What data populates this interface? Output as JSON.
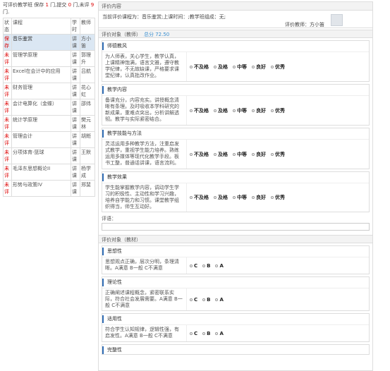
{
  "summary": {
    "prefix": "可评价教学班 ",
    "saved_label": "保存",
    "saved_count": "1",
    "mid": " 门,提交 ",
    "submitted_count": "0",
    "mid2": " 门,未评 ",
    "pending_count": "9",
    "suffix": " 门."
  },
  "course_table": {
    "headers": [
      "状态",
      "课程",
      "学时",
      "教师"
    ],
    "rows": [
      {
        "status": "保存",
        "course": "音乐鉴赏",
        "hours": "讲课",
        "teacher": "方小笛",
        "selected": true
      },
      {
        "status": "未评",
        "course": "管理学原理",
        "hours": "讲课",
        "teacher": "郭理升"
      },
      {
        "status": "未评",
        "course": "Excel在会计中的应用",
        "hours": "讲课",
        "teacher": "吕航"
      },
      {
        "status": "未评",
        "course": "财务管理",
        "hours": "讲课",
        "teacher": "花心虹"
      },
      {
        "status": "未评",
        "course": "会计电算化（金蝶）",
        "hours": "讲课",
        "teacher": "邵纬"
      },
      {
        "status": "未评",
        "course": "统计学原理",
        "hours": "讲课",
        "teacher": "樊元林"
      },
      {
        "status": "未评",
        "course": "管理会计",
        "hours": "讲课",
        "teacher": "胡銋"
      },
      {
        "status": "未评",
        "course": "分项体育-篮球",
        "hours": "讲课",
        "teacher": "王默"
      },
      {
        "status": "未评",
        "course": "毛泽东思想概论II",
        "hours": "讲课",
        "teacher": "杨学成"
      },
      {
        "status": "未评",
        "course": "形势与政策IV",
        "hours": "讲课",
        "teacher": "郑斐"
      }
    ]
  },
  "eval": {
    "panel_title": "评价内容",
    "info_line": "当前评价课程为：音乐鉴赏;上课时间：;教学班组成：无;",
    "teacher_line": "评价教师：方小笛",
    "teacher_section": {
      "title": "评价对象（教师）",
      "score": "总分 72.50",
      "criteria": [
        {
          "title": "师德教风",
          "desc": "为人师表，关心学生，教学认真，上课精神饱满，语言文雅，遵守教学纪律，不无故缺课，严格要求课堂纪律，认真批改作业。",
          "options": [
            "不及格",
            "及格",
            "中等",
            "良好",
            "优秀"
          ]
        },
        {
          "title": "教学内容",
          "desc": "备课充分，内容充实。讲授概念清晰有条理。及时吸收本学科研究的新成果，重难点突出，分析讲解透彻。教学与实际紧密结合。",
          "options": [
            "不及格",
            "及格",
            "中等",
            "良好",
            "优秀"
          ]
        },
        {
          "title": "教学技能与方法",
          "desc": "灵活运用多种教学方法，注重启发式教学，重视学生能力培养。熟练运用多媒体等现代化教学手段。板书工整，普通话讲课，语言流利。",
          "options": [
            "不及格",
            "及格",
            "中等",
            "良好",
            "优秀"
          ]
        },
        {
          "title": "教学效果",
          "desc": "学生能掌握教学内容，调动学生学习的积极性、主动性和学习兴趣，培养自学能力和习惯。课堂教学组织得当，师生互动好。",
          "options": [
            "不及格",
            "及格",
            "中等",
            "良好",
            "优秀"
          ]
        }
      ],
      "comment_label": "评语："
    },
    "material_section": {
      "title": "评价对象（教材）",
      "criteria": [
        {
          "title": "思想性",
          "desc": "思想观点正确，层次分明，条理清晰。A满意 B一般 C不满意",
          "options": [
            "C",
            "B",
            "A"
          ]
        },
        {
          "title": "理论性",
          "desc": "正确阐述课程概念，紧密联系实际，符合社会发展需要。A满意 B一般 C不满意",
          "options": [
            "C",
            "B",
            "A"
          ]
        },
        {
          "title": "适用性",
          "desc": "符合学生认知规律，逻辑性强，有启发性。A满意 B一般 C不满意",
          "options": [
            "C",
            "B",
            "A"
          ]
        },
        {
          "title": "完整性",
          "desc": "",
          "options": []
        }
      ]
    }
  }
}
